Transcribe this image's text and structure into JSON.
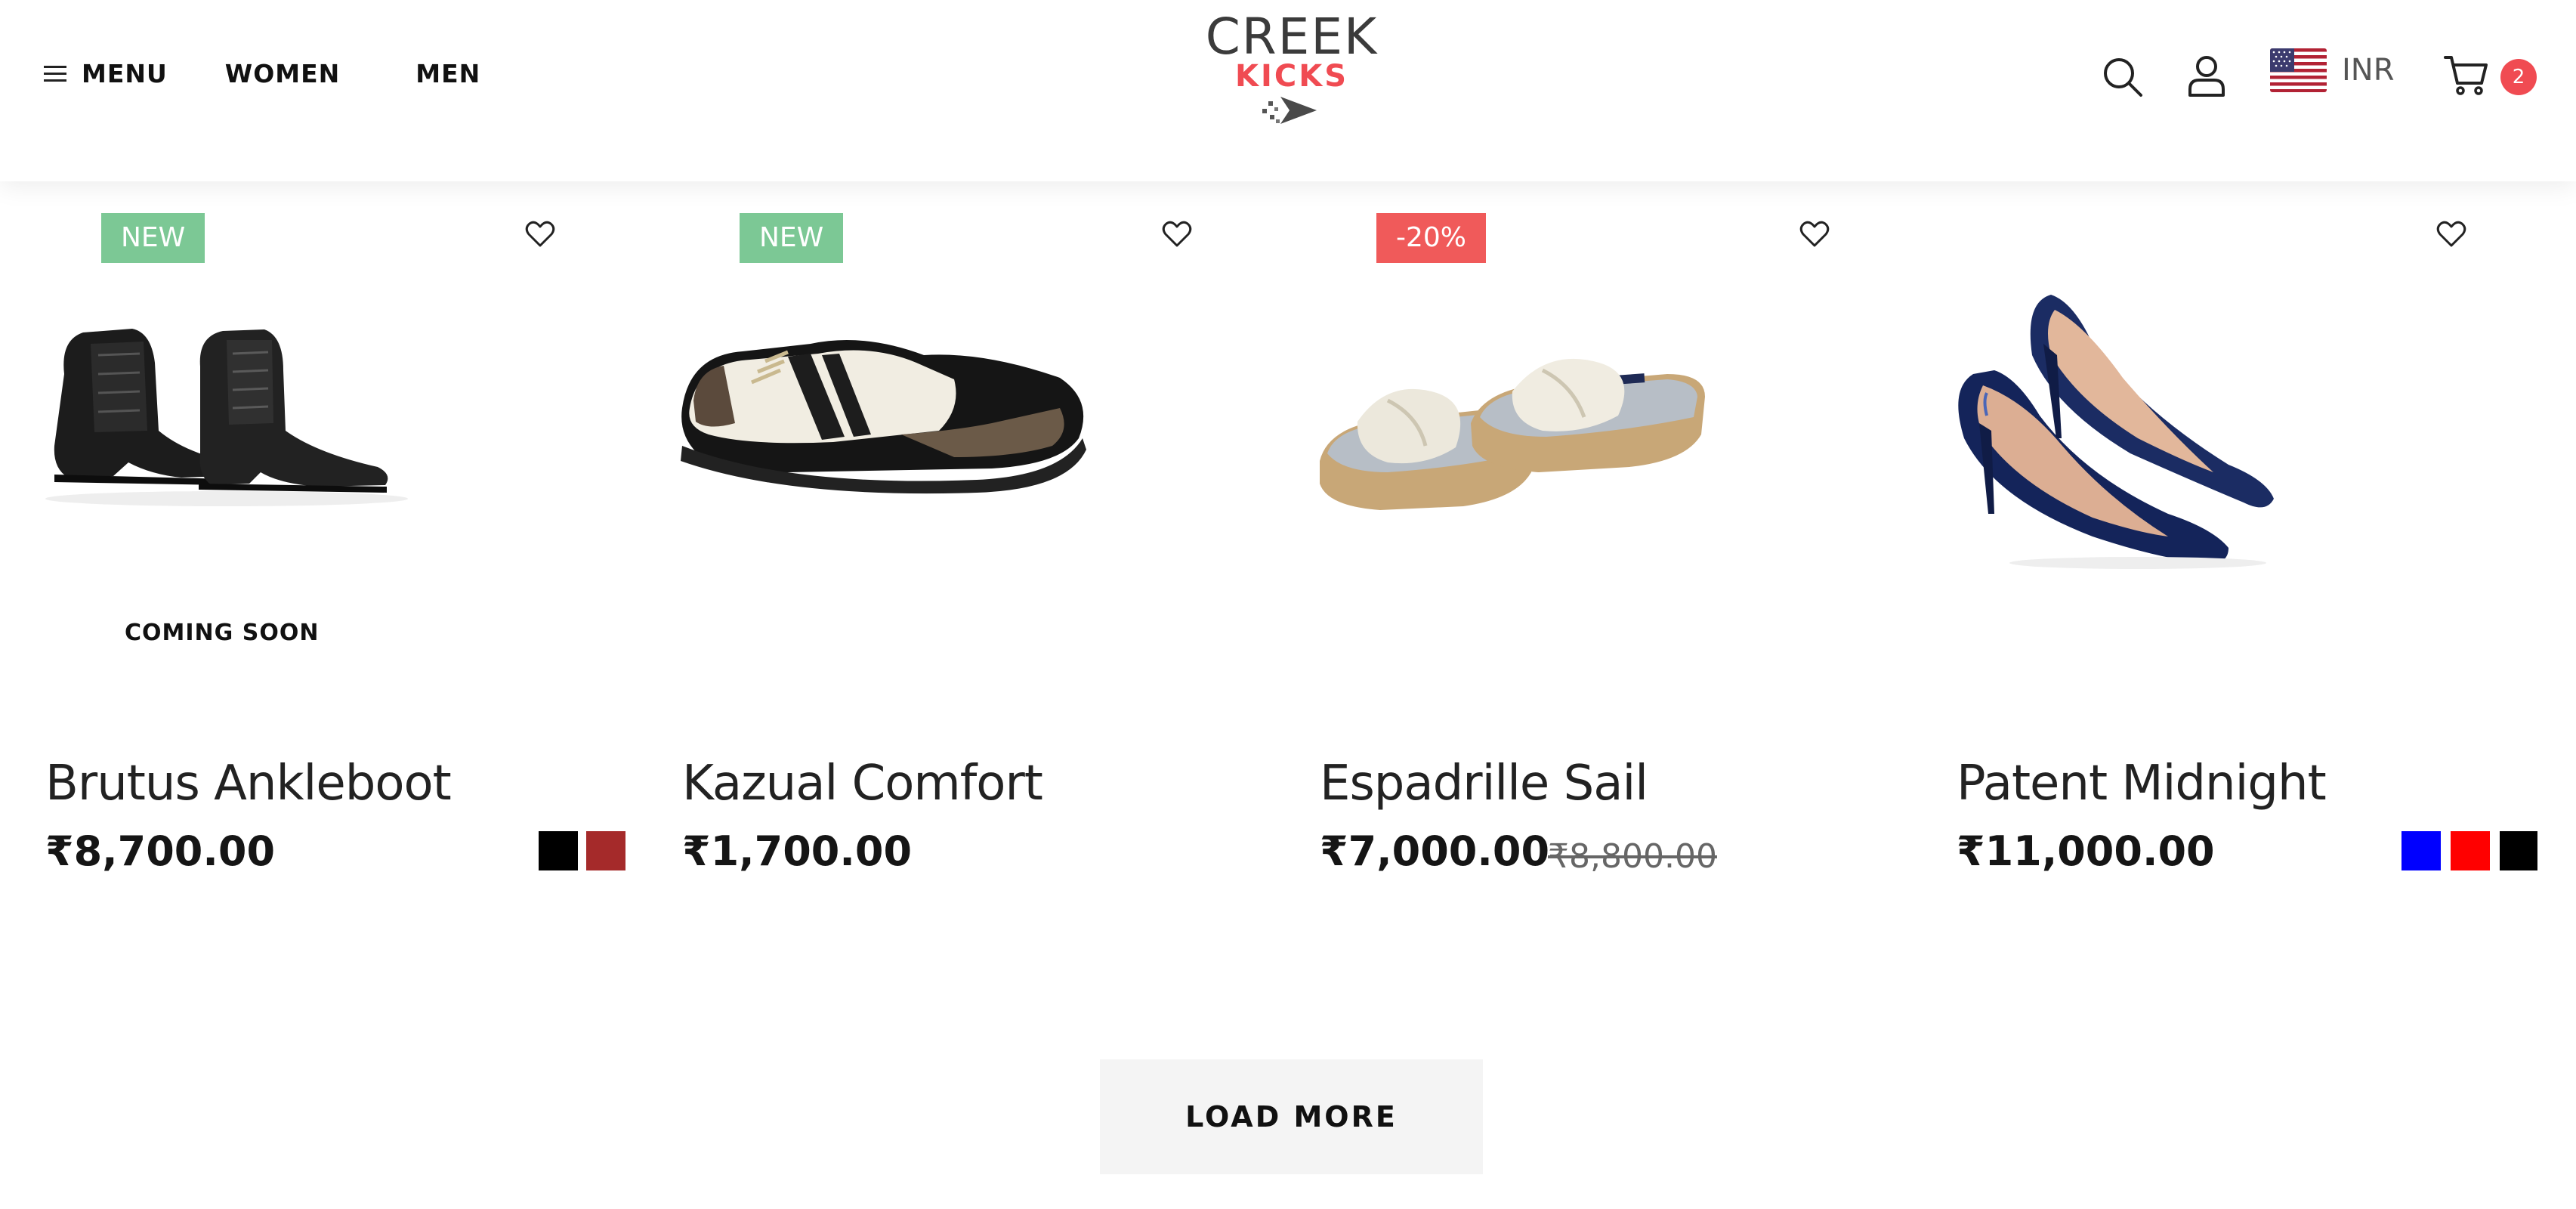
{
  "header": {
    "menu_label": "MENU",
    "nav": [
      {
        "label": "WOMEN"
      },
      {
        "label": "MEN"
      }
    ],
    "logo": {
      "line1": "CREEK",
      "line2": "KICKS"
    },
    "currency": "INR",
    "cart_count": "2",
    "icons": [
      "hamburger-icon",
      "search-icon",
      "account-icon",
      "us-flag-icon",
      "cart-icon"
    ]
  },
  "products": [
    {
      "name": "Brutus Ankleboot",
      "price": "₹8,700.00",
      "badge": "NEW",
      "overlay": "COMING SOON",
      "swatches": [
        "#000000",
        "#a52a2a"
      ]
    },
    {
      "name": "Kazual Comfort",
      "price": "₹1,700.00",
      "badge": "NEW",
      "swatches": []
    },
    {
      "name": "Espadrille Sail",
      "price": "₹7,000.00",
      "old_price": "₹8,800.00",
      "badge": "-20%",
      "swatches": []
    },
    {
      "name": "Patent Midnight",
      "price": "₹11,000.00",
      "swatches": [
        "#0000ff",
        "#ff0000",
        "#000000"
      ]
    }
  ],
  "load_more_label": "LOAD MORE",
  "colors": {
    "accent": "#f04b52",
    "new_badge": "#7cc895",
    "sale_badge": "#f05a5a"
  }
}
